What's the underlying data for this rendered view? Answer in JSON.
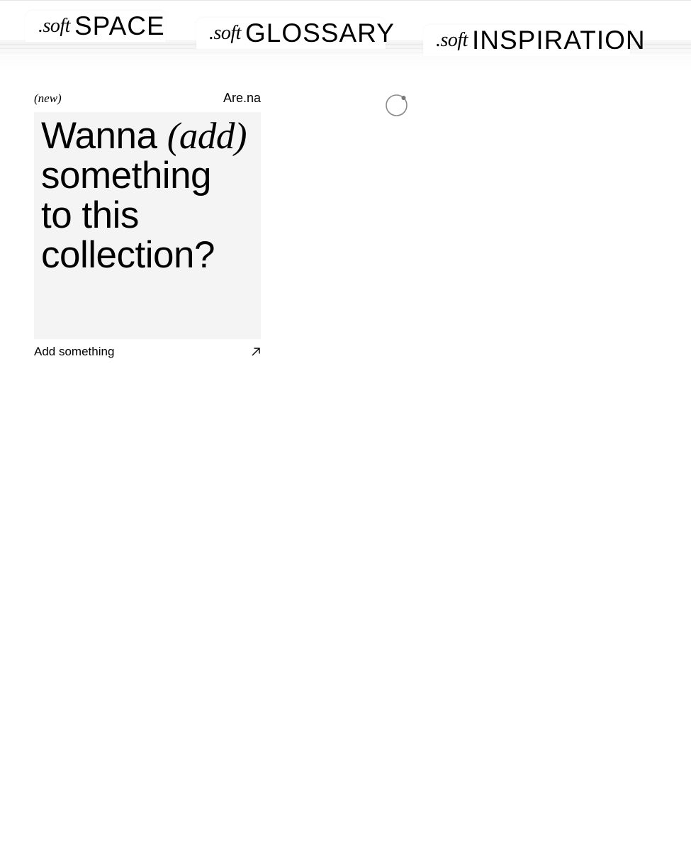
{
  "tabs": [
    {
      "prefix": ".soft",
      "name": "SPACE"
    },
    {
      "prefix": ".soft",
      "name": "GLOSSARY"
    },
    {
      "prefix": ".soft",
      "name": "INSPIRATION"
    }
  ],
  "card": {
    "tag": "(new)",
    "source": "Are.na",
    "heading_pre": "Wanna ",
    "heading_italic": "(add)",
    "heading_line2": "something",
    "heading_line3": "to this",
    "heading_line4": "collection?",
    "action_label": "Add something",
    "action_icon": "arrow-up-right-icon"
  },
  "loader": {
    "icon": "loading-spinner-icon"
  }
}
